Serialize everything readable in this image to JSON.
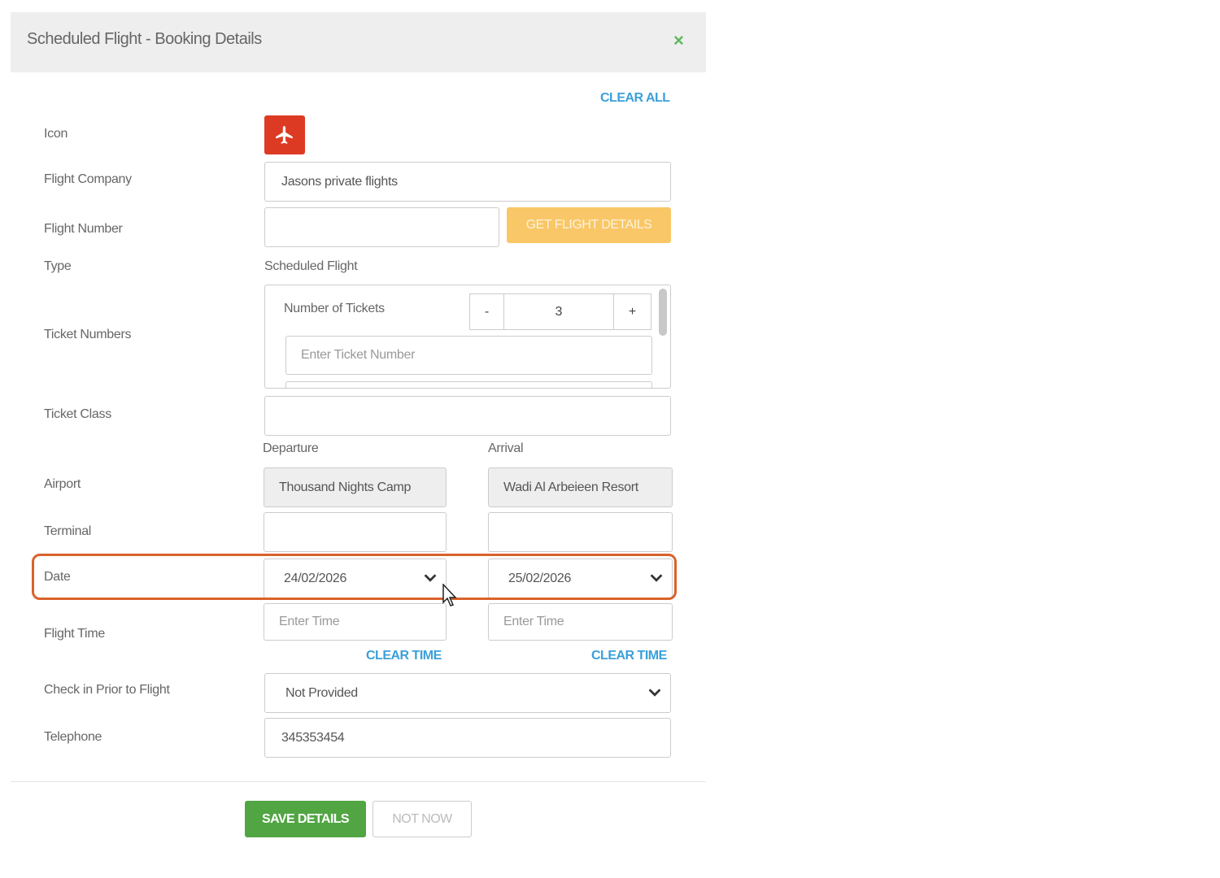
{
  "header": {
    "title": "Scheduled Flight - Booking Details",
    "close_symbol": "×"
  },
  "clear_all": "CLEAR ALL",
  "labels": {
    "icon": "Icon",
    "flight_company": "Flight Company",
    "flight_number": "Flight Number",
    "type": "Type",
    "ticket_numbers": "Ticket Numbers",
    "ticket_class": "Ticket Class",
    "airport": "Airport",
    "terminal": "Terminal",
    "date": "Date",
    "flight_time": "Flight Time",
    "check_in": "Check in Prior to Flight",
    "telephone": "Telephone"
  },
  "icon": {
    "name": "airplane-icon",
    "color": "#dd3a24"
  },
  "flight_company": {
    "value": "Jasons private flights"
  },
  "flight_number": {
    "value": "",
    "button": "GET FLIGHT DETAILS"
  },
  "type": {
    "value": "Scheduled Flight"
  },
  "tickets": {
    "count_label": "Number of Tickets",
    "minus": "-",
    "plus": "+",
    "count": "3",
    "input_placeholder": "Enter Ticket Number"
  },
  "ticket_class": {
    "value": ""
  },
  "columns": {
    "departure": "Departure",
    "arrival": "Arrival"
  },
  "departure": {
    "airport": "Thousand Nights Camp",
    "terminal": "",
    "date": "24/02/2026",
    "time_placeholder": "Enter Time",
    "clear_time": "CLEAR TIME"
  },
  "arrival": {
    "airport": "Wadi Al Arbeieen Resort",
    "terminal": "",
    "date": "25/02/2026",
    "time_placeholder": "Enter Time",
    "clear_time": "CLEAR TIME"
  },
  "check_in": {
    "value": "Not Provided"
  },
  "telephone": {
    "value": "345353454"
  },
  "footer": {
    "save": "SAVE DETAILS",
    "not_now": "NOT NOW"
  },
  "colors": {
    "accent_link": "#3ba0d8",
    "save": "#52a543",
    "get_details": "#f9c767",
    "highlight": "#d9622b"
  }
}
